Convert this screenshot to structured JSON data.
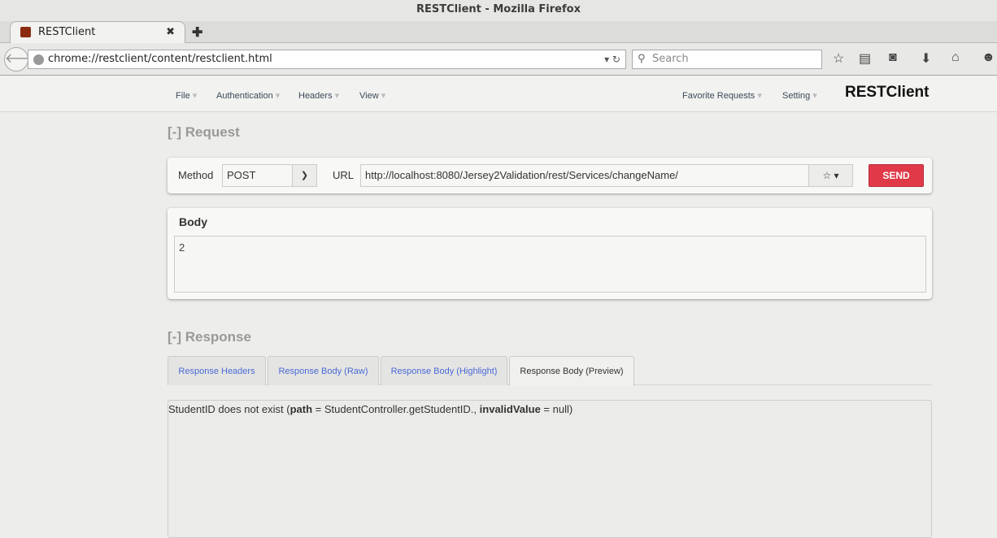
{
  "window": {
    "title": "RESTClient - Mozilla Firefox"
  },
  "browser": {
    "tab_title": "RESTClient",
    "url": "chrome://restclient/content/restclient.html",
    "search_placeholder": "Search"
  },
  "app": {
    "menu_left": [
      "File",
      "Authentication",
      "Headers",
      "View"
    ],
    "menu_right": [
      "Favorite Requests",
      "Setting"
    ],
    "brand": "RESTClient",
    "request": {
      "section_title": "[-] Request",
      "method_label": "Method",
      "method_value": "POST",
      "url_label": "URL",
      "url_value": "http://localhost:8080/Jersey2Validation/rest/Services/changeName/",
      "send_label": "SEND",
      "body_label": "Body",
      "body_value": "2"
    },
    "response": {
      "section_title": "[-] Response",
      "tabs": [
        "Response Headers",
        "Response Body (Raw)",
        "Response Body (Highlight)",
        "Response Body (Preview)"
      ],
      "active_tab": "Response Body (Preview)",
      "preview": {
        "t1": "StudentID does not exist (",
        "k1": "path",
        "t2": " = StudentController.getStudentID., ",
        "k2": "invalidValue",
        "t3": " = null)"
      }
    }
  },
  "colors": {
    "send": "#e03a48",
    "tab_link": "#4a6ad8"
  }
}
